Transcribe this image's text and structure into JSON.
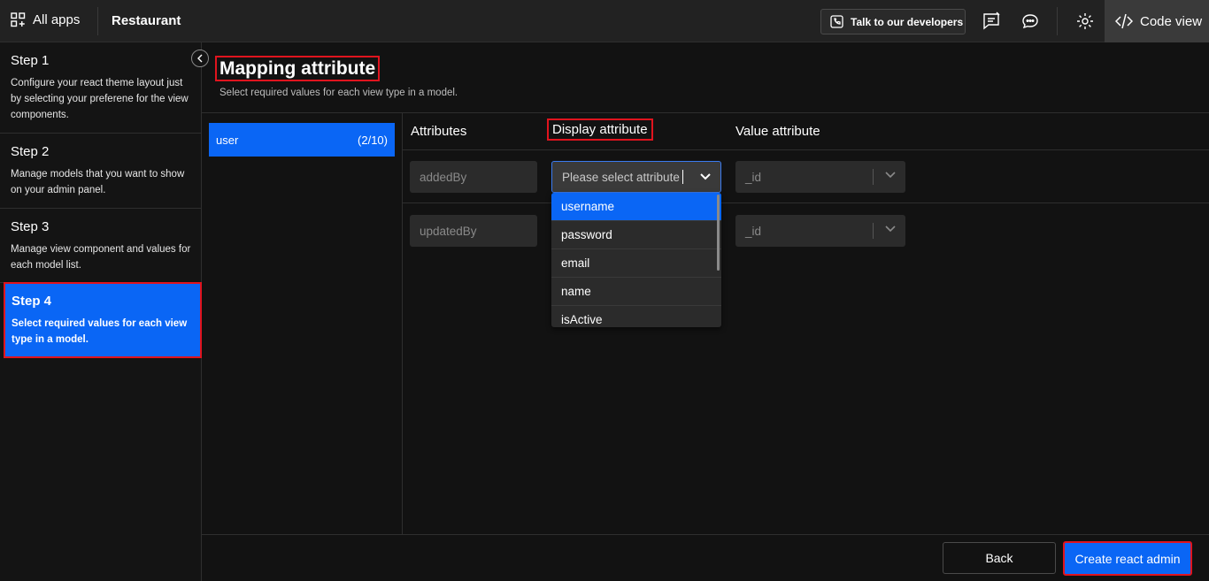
{
  "topbar": {
    "all_apps_label": "All apps",
    "project_name": "Restaurant",
    "talk_label": "Talk to our developers",
    "code_view_label": "Code view"
  },
  "steps": [
    {
      "title": "Step 1",
      "desc": "Configure your react theme layout just by selecting your preferene for the view components."
    },
    {
      "title": "Step 2",
      "desc": "Manage models that you want to show on your admin panel."
    },
    {
      "title": "Step 3",
      "desc": "Manage view component and values for each model list."
    },
    {
      "title": "Step 4",
      "desc": "Select required values for each view type in a model."
    }
  ],
  "main": {
    "title": "Mapping attribute",
    "subtitle": "Select required values for each view type in a model."
  },
  "models": [
    {
      "name": "user",
      "count": "(2/10)"
    }
  ],
  "columns": {
    "attributes": "Attributes",
    "display": "Display attribute",
    "value": "Value attribute"
  },
  "rows": [
    {
      "attribute": "addedBy",
      "display_placeholder": "Please select attribute",
      "value": "_id"
    },
    {
      "attribute": "updatedBy",
      "value": "_id"
    }
  ],
  "dropdown_options": [
    "username",
    "password",
    "email",
    "name",
    "isActive"
  ],
  "buttons": {
    "back": "Back",
    "create": "Create react admin"
  }
}
